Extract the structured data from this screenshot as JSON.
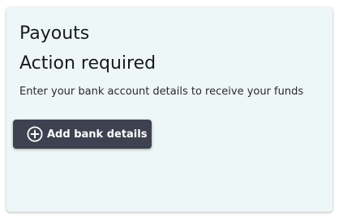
{
  "payouts_card": {
    "title": "Payouts",
    "status": "Action required",
    "description": "Enter your bank account details to receive your funds",
    "add_bank_button": {
      "label": "Add bank details",
      "icon": "plus-circle-icon"
    }
  },
  "colors": {
    "card_background": "#eef7f8",
    "button_background": "#3d4150",
    "button_text": "#ffffff",
    "text": "#1a1a1a"
  }
}
